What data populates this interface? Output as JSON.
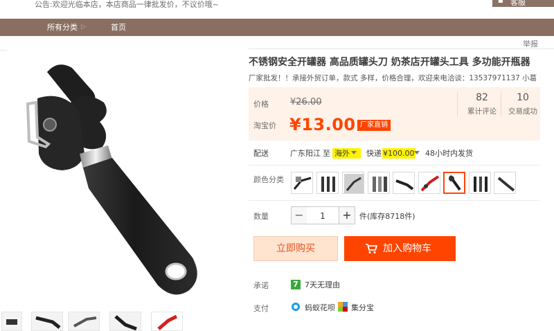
{
  "topbar": {
    "notice": "公告:欢迎光临本店，本店商品一律批发价，不议价哦~",
    "customer_service": "客服"
  },
  "nav": {
    "all_categories": "所有分类",
    "home": "首页"
  },
  "report": "举报",
  "product": {
    "title": "不锈钢安全开罐器 高品质罐头刀 奶茶店开罐头工具 多功能开瓶器",
    "subtitle": "厂家批发！！承接外贸订单，款式 多样，价格合理，欢迎来电洽谈：13537971137 小葛"
  },
  "price": {
    "price_label": "价格",
    "original_price": "¥26.00",
    "taobao_label": "淘宝价",
    "sale_price": "¥13.00",
    "badge": "厂家直销",
    "reviews_count": "82",
    "reviews_label": "累计评论",
    "sales_count": "10",
    "sales_label": "交易成功"
  },
  "delivery": {
    "label": "配送",
    "from": "广东阳江",
    "to_word": "至",
    "destination": "海外",
    "method": "快递",
    "fee": "¥100.00",
    "ship_time": "48小时内发货"
  },
  "color": {
    "label": "颜色分类",
    "swatch_count": 9,
    "selected_index": 6
  },
  "quantity": {
    "label": "数量",
    "value": "1",
    "minus": "−",
    "plus": "+",
    "stock": "件(库存8718件)"
  },
  "actions": {
    "buy_now": "立即购买",
    "add_to_cart": "加入购物车"
  },
  "promise": {
    "label": "承诺",
    "text": "7天无理由",
    "icon_glyph": "7"
  },
  "payment": {
    "label": "支付",
    "methods": [
      "蚂蚁花呗",
      "集分宝"
    ]
  },
  "colors": {
    "accent": "#ff4400",
    "nav_bg": "#8a6f60",
    "price_bg": "#fff2e8",
    "highlight": "#fff200"
  }
}
